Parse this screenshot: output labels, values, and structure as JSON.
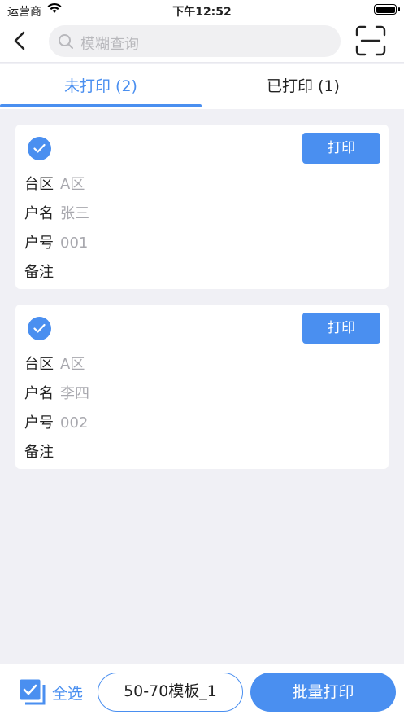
{
  "status_bar": {
    "carrier": "运营商",
    "time": "下午12:52"
  },
  "search": {
    "placeholder": "模糊查询"
  },
  "tabs": [
    {
      "label": "未打印 (2)",
      "active": true
    },
    {
      "label": "已打印 (1)",
      "active": false
    }
  ],
  "card_labels": {
    "area": "台区",
    "name": "户名",
    "number": "户号",
    "note": "备注",
    "print": "打印"
  },
  "records": [
    {
      "area": "A区",
      "name": "张三",
      "number": "001",
      "note": "",
      "checked": true
    },
    {
      "area": "A区",
      "name": "李四",
      "number": "002",
      "note": "",
      "checked": true
    }
  ],
  "bottom": {
    "select_all": "全选",
    "template": "50-70模板_1",
    "batch_print": "批量打印"
  },
  "colors": {
    "accent": "#4a8ff0",
    "background": "#f0f0f5"
  }
}
